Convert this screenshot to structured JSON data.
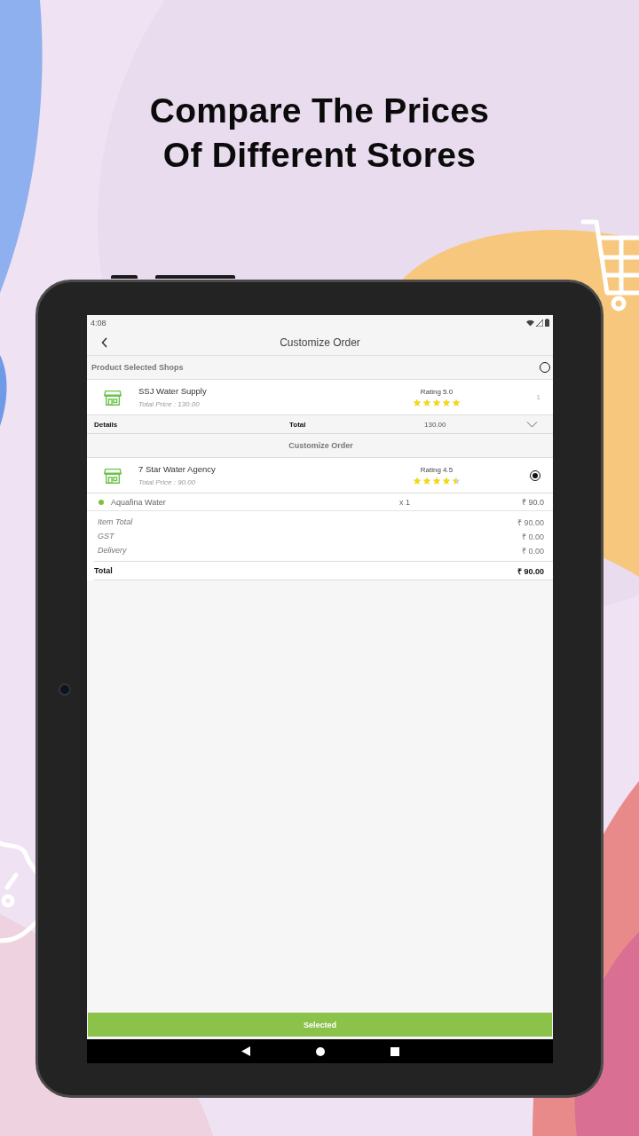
{
  "headline": [
    "Compare The Prices",
    "Of Different Stores"
  ],
  "status_bar": {
    "time": "4:08"
  },
  "app_bar": {
    "title": "Customize Order"
  },
  "compare_section": {
    "title": "Product Selected Shops",
    "selected": false,
    "shop": {
      "name": "SSJ Water Supply",
      "total_price": "Total Price : 130.00",
      "rating": "Rating 5.0",
      "stars": 5,
      "count": "1"
    },
    "details": {
      "label": "Details",
      "total_label": "Total",
      "total": "130.00",
      "expanded": false
    }
  },
  "customize_section": {
    "title": "Customize Order",
    "shop": {
      "name": "7 Star Water  Agency",
      "total_price": "Total Price : 90.00",
      "rating": "Rating 4.5",
      "stars": 4.5,
      "selected": true
    },
    "items": [
      {
        "name": "Aquafina Water",
        "qty": "x 1",
        "price": "₹ 90.0",
        "color": "#7ac143"
      }
    ],
    "summary": [
      {
        "label": "Item Total",
        "value": "₹ 90.00"
      },
      {
        "label": "GST",
        "value": "₹ 0.00"
      },
      {
        "label": "Delivery",
        "value": "₹ 0.00"
      }
    ],
    "total": {
      "label": "Total",
      "value": "₹ 90.00"
    }
  },
  "action_button": {
    "label": "Selected"
  }
}
